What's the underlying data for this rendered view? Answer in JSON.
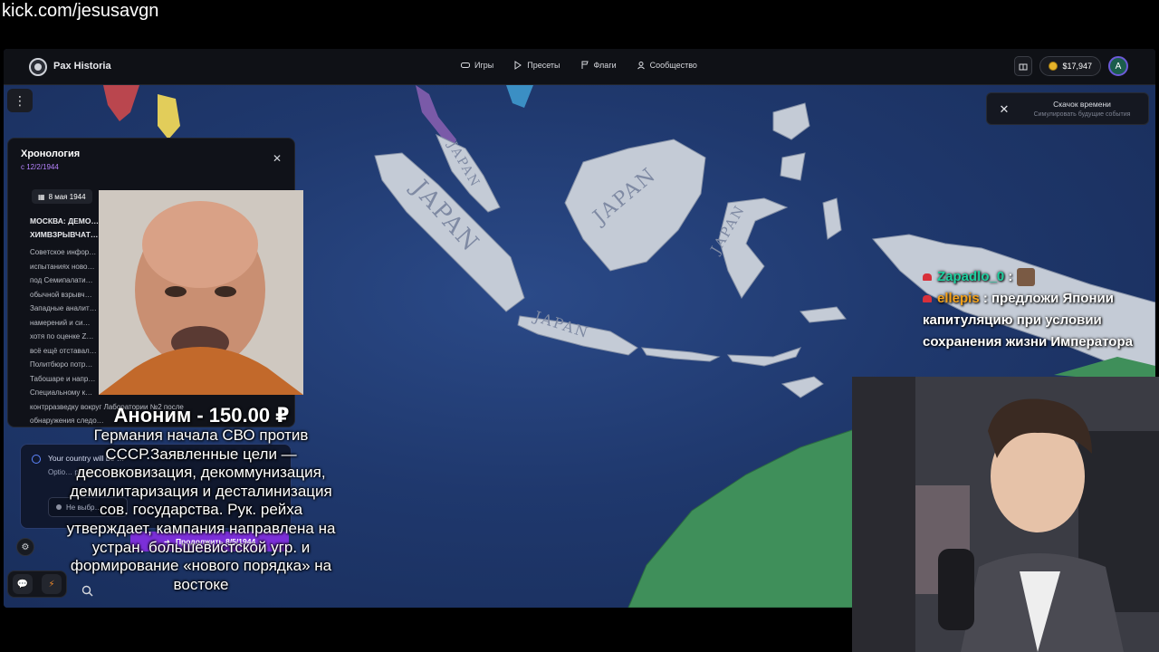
{
  "stream": {
    "url": "kick.com/jesusavgn"
  },
  "app": {
    "title": "Pax Historia",
    "nav": [
      {
        "label": "Игры",
        "icon": "gamepad-icon"
      },
      {
        "label": "Пресеты",
        "icon": "play-icon"
      },
      {
        "label": "Флаги",
        "icon": "flag-icon"
      },
      {
        "label": "Сообщество",
        "icon": "users-icon"
      }
    ],
    "balance": "$17,947",
    "avatar_letter": "A"
  },
  "timejump": {
    "title": "Скачок времени",
    "subtitle": "Симулировать будущие события"
  },
  "timeline": {
    "title": "Хронология",
    "since": "с 12/2/1944",
    "date": "8 мая 1944",
    "headline": "МОСКВА: ДЕМО… ХИМВЗРЫВЧАТ…",
    "body_lines": [
      "Советское инфор…",
      "испытаниях ново…",
      "под Семипалати…",
      "обычной взрывч…",
      "Западные аналит…",
      "намерений и си…",
      "хотя по оценке Z…",
      "всё ещё отставал…",
      "Политбюро потр…",
      "Табошаре и напр…",
      "Специальному к…",
      "контрразведку вокруг Лаборатории №2 после",
      "обнаружения следо…"
    ]
  },
  "notice": {
    "title": "Your country will be …",
    "text": "Optio… playing as, if you'd like to:",
    "select_value": "Не выбр…"
  },
  "continue_button": "Продолжить 8/5/1944",
  "map_labels": [
    "JAPAN",
    "JAPAN",
    "JAPAN",
    "JAPAN",
    "JAPAN"
  ],
  "donation": {
    "title": "Аноним - 150.00 ₽",
    "message_lines": [
      "Германия начала СВО против",
      "СССР.Заявленные цели —",
      "десовковизация, декоммунизация,",
      "демилитаризация и десталинизация",
      "сов. государства. Рук. рейха",
      "утверждает, кампания направлена на",
      "устран. большевистской угр. и",
      "формирование «нового порядка» на",
      "востоке"
    ]
  },
  "chat": [
    {
      "user": "Zapadlo_0",
      "message": ""
    },
    {
      "user": "ellepis",
      "message": "предложи Японии капитуляцию при условии сохранения жизни Императора"
    }
  ]
}
